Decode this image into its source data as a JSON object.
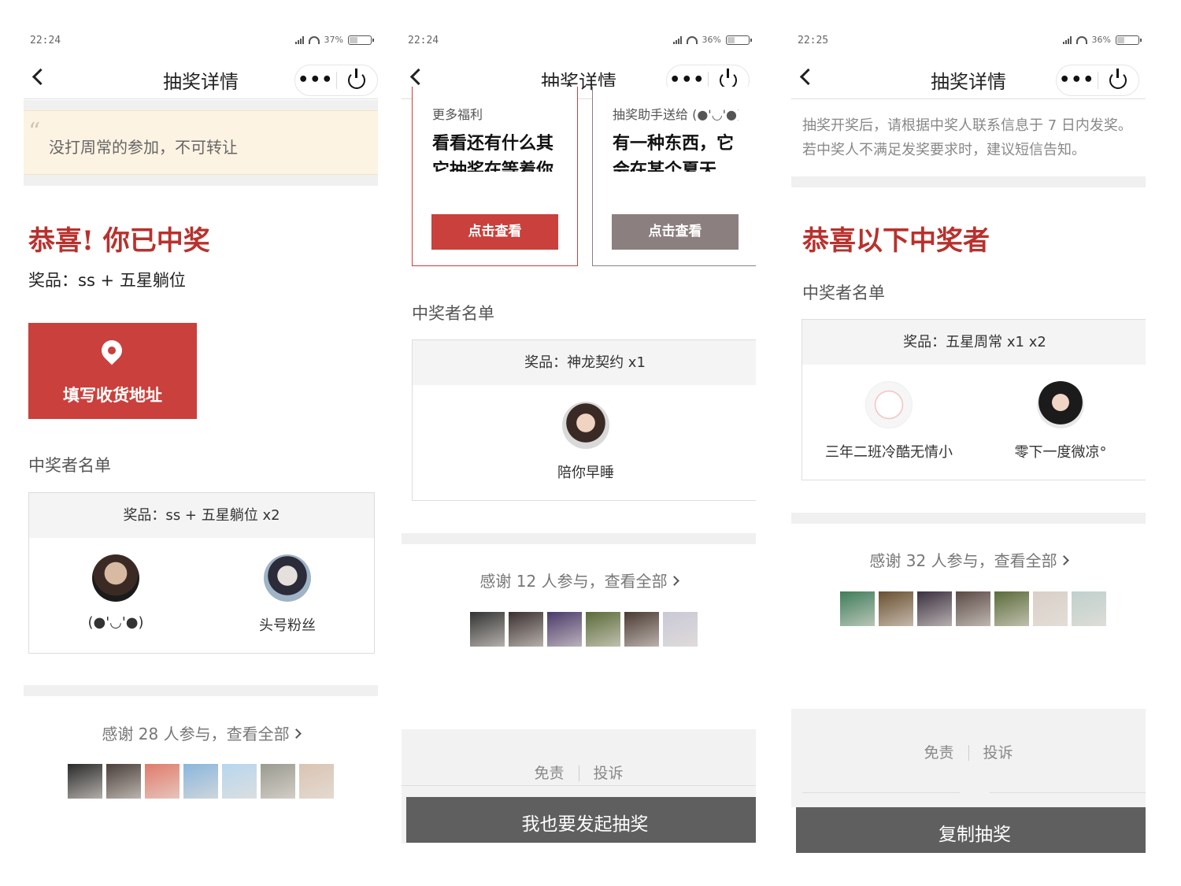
{
  "screens": [
    {
      "status": {
        "time": "22:24",
        "battery": "37%",
        "battery_level": 0.37
      },
      "nav": {
        "title": "抽奖详情"
      },
      "notice": {
        "text": "没打周常的参加，不可转让"
      },
      "win_title": "恭喜! 你已中奖",
      "prize_line": "奖品：ss + 五星躺位",
      "address_button": "填写收货地址",
      "winners_label": "中奖者名单",
      "prize_box": {
        "header": "奖品：ss + 五星躺位 x2",
        "winners": [
          {
            "name": "(●'◡'●)"
          },
          {
            "name": "头号粉丝"
          }
        ]
      },
      "thanks": "感谢 28 人参与，查看全部",
      "participants_colors": [
        "#2a2a2a",
        "#4a3f3a",
        "#e07b6a",
        "#8ab6dd",
        "#b7d6ee",
        "#9a9a90",
        "#d9c4b4"
      ]
    },
    {
      "status": {
        "time": "22:24",
        "battery": "36%",
        "battery_level": 0.36
      },
      "nav": {
        "title": "抽奖详情"
      },
      "cards": [
        {
          "tag": "更多福利",
          "desc": "看看还有什么其它抽奖在等着你",
          "button": "点击查看",
          "color": "#c9403c"
        },
        {
          "tag": "抽奖助手送给 (●'◡'●)",
          "desc": "有一种东西，它会在某个夏天…",
          "button": "点击查看",
          "color": "#8c7f7f"
        }
      ],
      "winners_label": "中奖者名单",
      "prize_box": {
        "header": "奖品：神龙契约 x1",
        "winners": [
          {
            "name": "陪你早睡"
          }
        ]
      },
      "thanks": "感谢 12 人参与，查看全部",
      "participants_colors": [
        "#333333",
        "#3a3030",
        "#4a3a6a",
        "#5b6b3a",
        "#4a3a33",
        "#c9c9d6"
      ],
      "footer": {
        "disclaimer": "免责",
        "report": "投诉"
      },
      "bottom_button": "我也要发起抽奖"
    },
    {
      "status": {
        "time": "22:25",
        "battery": "36%",
        "battery_level": 0.36
      },
      "nav": {
        "title": "抽奖详情"
      },
      "disclaimer_text": "抽奖开奖后，请根据中奖人联系信息于 7 日内发奖。若中奖人不满足发奖要求时，建议短信告知。",
      "win_title": "恭喜以下中奖者",
      "winners_label": "中奖者名单",
      "prize_box": {
        "header": "奖品：五星周常 x1 x2",
        "winners": [
          {
            "name": "三年二班冷酷无情小"
          },
          {
            "name": "零下一度微凉°"
          }
        ]
      },
      "thanks": "感谢 32 人参与，查看全部",
      "participants_colors": [
        "#3f7d5a",
        "#6a5030",
        "#3a3040",
        "#5a4a44",
        "#5b6b3a",
        "#d8d0c8",
        "#c0d0cc"
      ],
      "footer": {
        "disclaimer": "免责",
        "report": "投诉"
      },
      "bottom_button": "复制抽奖"
    }
  ]
}
